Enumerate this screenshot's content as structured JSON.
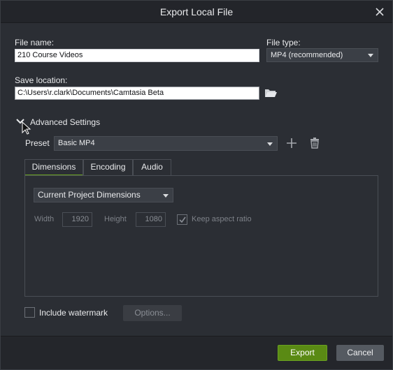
{
  "dialog": {
    "title": "Export Local File"
  },
  "file_name": {
    "label": "File name:",
    "value": "210 Course Videos"
  },
  "file_type": {
    "label": "File type:",
    "selected": "MP4 (recommended)"
  },
  "save_location": {
    "label": "Save location:",
    "value": "C:\\Users\\r.clark\\Documents\\Camtasia Beta"
  },
  "advanced": {
    "label": "Advanced Settings",
    "preset_label": "Preset",
    "preset_selected": "Basic MP4"
  },
  "tabs": [
    {
      "label": "Dimensions",
      "active": true
    },
    {
      "label": "Encoding",
      "active": false
    },
    {
      "label": "Audio",
      "active": false
    }
  ],
  "dimensions": {
    "mode_selected": "Current Project Dimensions",
    "width_label": "Width",
    "width_value": "1920",
    "height_label": "Height",
    "height_value": "1080",
    "keep_aspect_label": "Keep aspect ratio",
    "keep_aspect_checked": true
  },
  "watermark": {
    "label": "Include watermark",
    "checked": false,
    "options_label": "Options..."
  },
  "footer": {
    "export_label": "Export",
    "cancel_label": "Cancel"
  },
  "colors": {
    "accent": "#6aa121",
    "background": "#2b2e34"
  }
}
